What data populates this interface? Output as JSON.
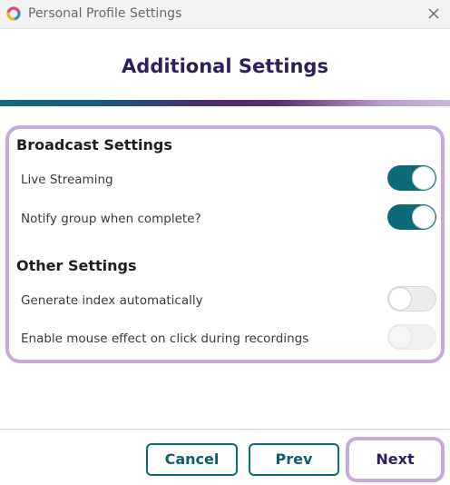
{
  "window": {
    "title": "Personal Profile Settings",
    "icons": {
      "logo": "app-logo-icon",
      "close": "close-icon"
    }
  },
  "page": {
    "title": "Additional Settings"
  },
  "broadcast": {
    "heading": "Broadcast Settings",
    "items": [
      {
        "label": "Live Streaming",
        "state": "on"
      },
      {
        "label": "Notify group when complete?",
        "state": "on"
      }
    ]
  },
  "other": {
    "heading": "Other Settings",
    "items": [
      {
        "label": "Generate index automatically",
        "state": "off"
      },
      {
        "label": "Enable mouse effect on click during recordings",
        "state": "disabled"
      }
    ]
  },
  "footer": {
    "cancel_label": "Cancel",
    "prev_label": "Prev",
    "next_label": "Next"
  },
  "colors": {
    "accent_teal": "#0d6b78",
    "title_purple": "#2e1f5c",
    "focus_lavender": "#c8a9dc"
  }
}
